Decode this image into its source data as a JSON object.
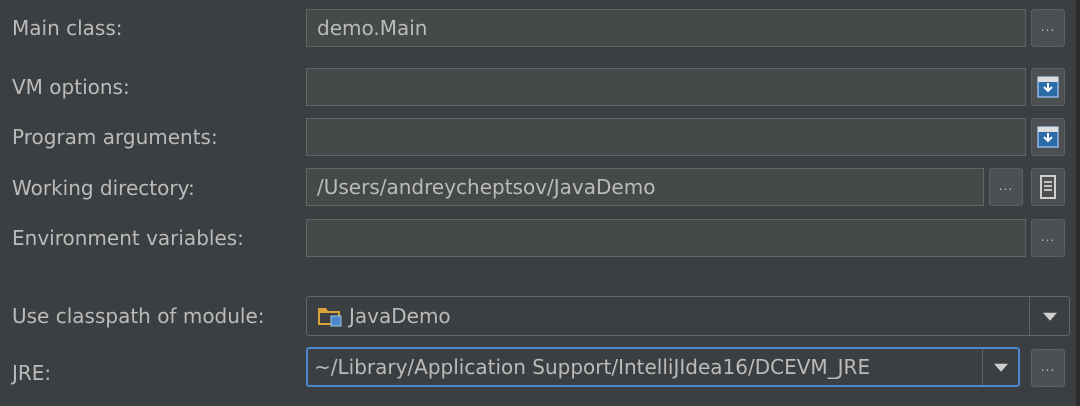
{
  "rows": {
    "main_class": {
      "label": "Main class:",
      "value": "demo.Main",
      "browse": "..."
    },
    "vm_options": {
      "label": "VM options:",
      "value": ""
    },
    "program_arguments": {
      "label": "Program arguments:",
      "value": ""
    },
    "working_directory": {
      "label": "Working directory:",
      "value": "/Users/andreycheptsov/JavaDemo",
      "browse": "..."
    },
    "environment_variables": {
      "label": "Environment variables:",
      "value": "",
      "browse": "..."
    },
    "classpath_module": {
      "label": "Use classpath of module:",
      "value": "JavaDemo"
    },
    "jre": {
      "label": "JRE:",
      "value": "~/Library/Application Support/IntelliJIdea16/DCEVM_JRE",
      "browse": "..."
    }
  },
  "icons": {
    "expand": "expand-field-icon",
    "macros": "macros-list-icon",
    "module": "module-folder-icon",
    "dropdown": "chevron-down-icon"
  },
  "colors": {
    "background": "#3c3f41",
    "field": "#45494a",
    "focus": "#4a88c7",
    "text": "#bbbbbb"
  }
}
